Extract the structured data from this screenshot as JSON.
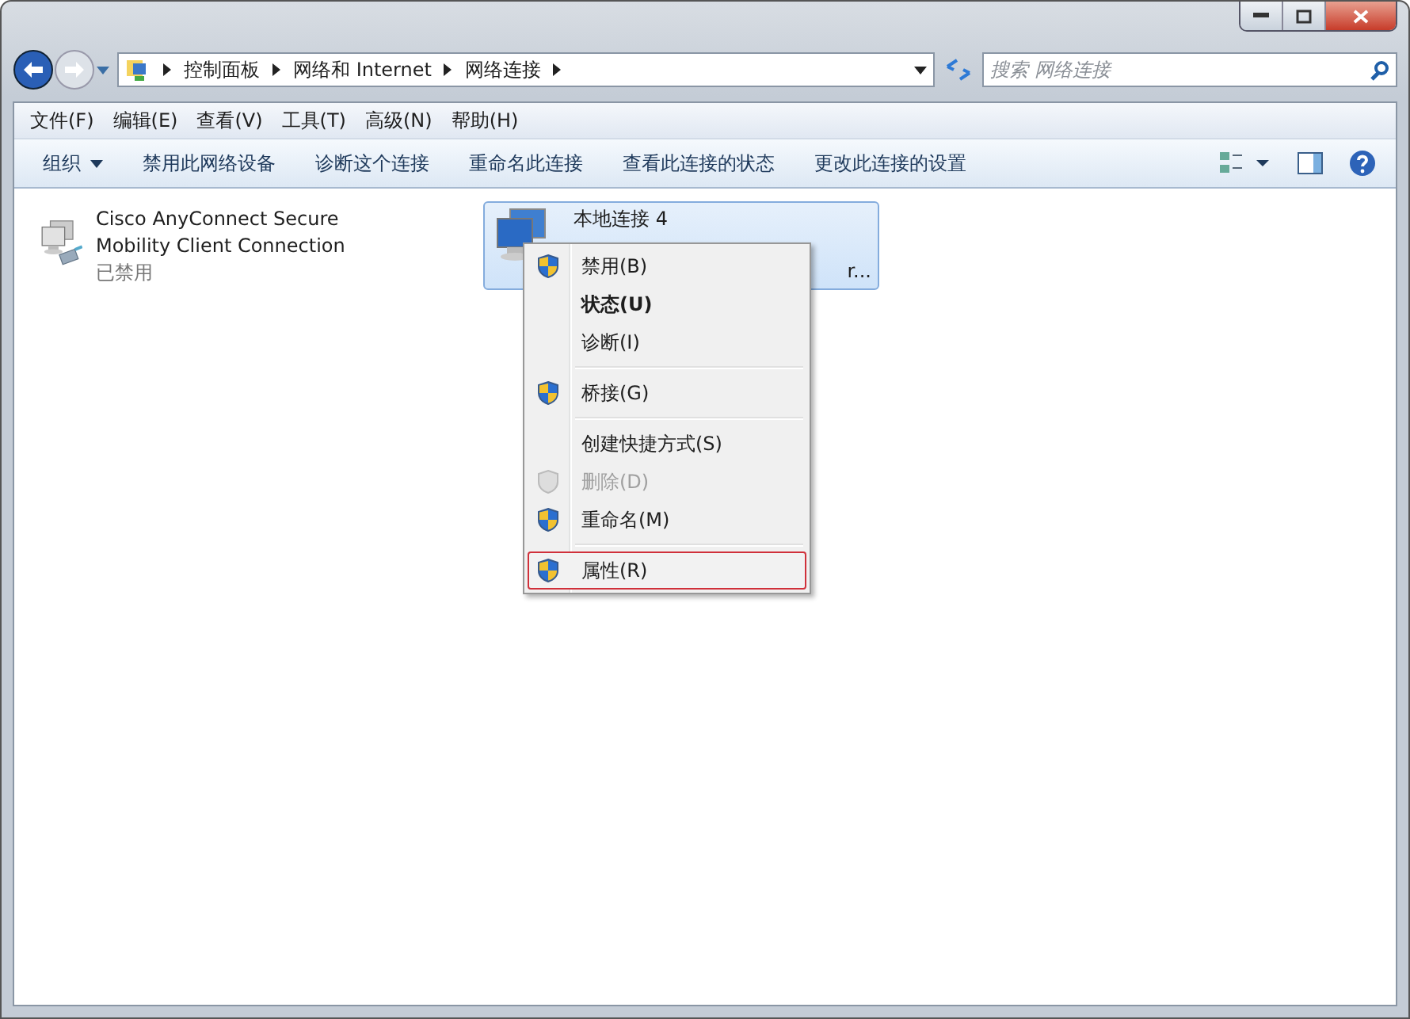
{
  "address_bar": {
    "path": [
      "控制面板",
      "网络和 Internet",
      "网络连接"
    ]
  },
  "search": {
    "placeholder": "搜索 网络连接"
  },
  "menu_bar": [
    "文件(F)",
    "编辑(E)",
    "查看(V)",
    "工具(T)",
    "高级(N)",
    "帮助(H)"
  ],
  "toolbar": [
    {
      "label": "组织",
      "dropdown": true
    },
    {
      "label": "禁用此网络设备",
      "dropdown": false
    },
    {
      "label": "诊断这个连接",
      "dropdown": false
    },
    {
      "label": "重命名此连接",
      "dropdown": false
    },
    {
      "label": "查看此连接的状态",
      "dropdown": false
    },
    {
      "label": "更改此连接的设置",
      "dropdown": false
    }
  ],
  "connections": [
    {
      "name": "Cisco AnyConnect Secure Mobility Client Connection",
      "status": "已禁用",
      "selected": false,
      "disabled": true
    },
    {
      "name": "本地连接 4",
      "status": "r...",
      "selected": true,
      "disabled": false
    }
  ],
  "context_menu": [
    {
      "kind": "item",
      "label": "禁用(B)",
      "shield": true,
      "bold": false,
      "disabled": false,
      "selected": false
    },
    {
      "kind": "item",
      "label": "状态(U)",
      "shield": false,
      "bold": true,
      "disabled": false,
      "selected": false
    },
    {
      "kind": "item",
      "label": "诊断(I)",
      "shield": false,
      "bold": false,
      "disabled": false,
      "selected": false
    },
    {
      "kind": "separator"
    },
    {
      "kind": "item",
      "label": "桥接(G)",
      "shield": true,
      "bold": false,
      "disabled": false,
      "selected": false
    },
    {
      "kind": "separator"
    },
    {
      "kind": "item",
      "label": "创建快捷方式(S)",
      "shield": false,
      "bold": false,
      "disabled": false,
      "selected": false
    },
    {
      "kind": "item",
      "label": "删除(D)",
      "shield": true,
      "bold": false,
      "disabled": true,
      "selected": false
    },
    {
      "kind": "item",
      "label": "重命名(M)",
      "shield": true,
      "bold": false,
      "disabled": false,
      "selected": false
    },
    {
      "kind": "separator"
    },
    {
      "kind": "item",
      "label": "属性(R)",
      "shield": true,
      "bold": false,
      "disabled": false,
      "selected": true
    }
  ]
}
